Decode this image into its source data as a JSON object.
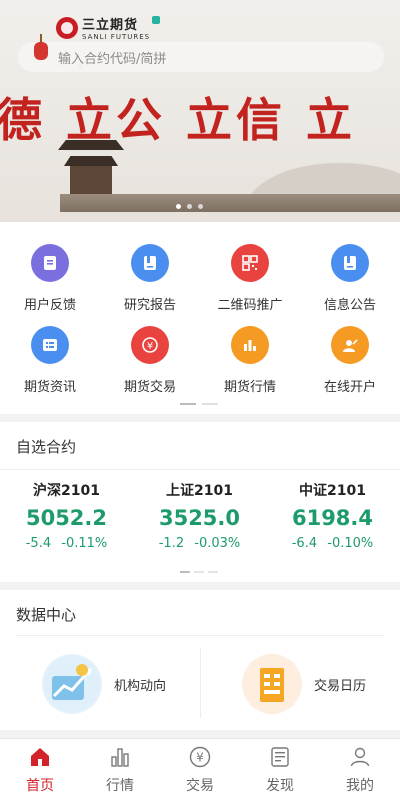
{
  "banner": {
    "logo_cn": "三立期货",
    "logo_en": "SANLI FUTURES",
    "search_placeholder": "输入合约代码/简拼",
    "slogan": "德 立公 立信 立"
  },
  "quick_menu": [
    {
      "label": "用户反馈",
      "icon": "feedback-icon",
      "color": "#7b6fe0"
    },
    {
      "label": "研究报告",
      "icon": "report-icon",
      "color": "#4a8ff0"
    },
    {
      "label": "二维码推广",
      "icon": "qrcode-icon",
      "color": "#e8433f"
    },
    {
      "label": "信息公告",
      "icon": "notice-icon",
      "color": "#4a8ff0"
    },
    {
      "label": "期货资讯",
      "icon": "news-icon",
      "color": "#4a8ff0"
    },
    {
      "label": "期货交易",
      "icon": "yen-icon",
      "color": "#e8433f"
    },
    {
      "label": "期货行情",
      "icon": "bar-chart-icon",
      "color": "#f59a23"
    },
    {
      "label": "在线开户",
      "icon": "account-open-icon",
      "color": "#f59a23"
    }
  ],
  "watchlist": {
    "title": "自选合约",
    "contracts": [
      {
        "name": "沪深2101",
        "price": "5052.2",
        "change": "-5.4",
        "pct": "-0.11%"
      },
      {
        "name": "上证2101",
        "price": "3525.0",
        "change": "-1.2",
        "pct": "-0.03%"
      },
      {
        "name": "中证2101",
        "price": "6198.4",
        "change": "-6.4",
        "pct": "-0.10%"
      }
    ],
    "down_color": "#1e9b6a"
  },
  "data_center": {
    "title": "数据中心",
    "cards": [
      {
        "label": "机构动向",
        "icon": "trend-chart-icon"
      },
      {
        "label": "交易日历",
        "icon": "calendar-icon"
      }
    ]
  },
  "tabbar": {
    "tabs": [
      {
        "label": "首页",
        "icon": "home-icon",
        "active": true
      },
      {
        "label": "行情",
        "icon": "market-icon",
        "active": false
      },
      {
        "label": "交易",
        "icon": "yen-circle-icon",
        "active": false
      },
      {
        "label": "发现",
        "icon": "discover-icon",
        "active": false
      },
      {
        "label": "我的",
        "icon": "user-icon",
        "active": false
      }
    ],
    "active_color": "#d3232a"
  }
}
